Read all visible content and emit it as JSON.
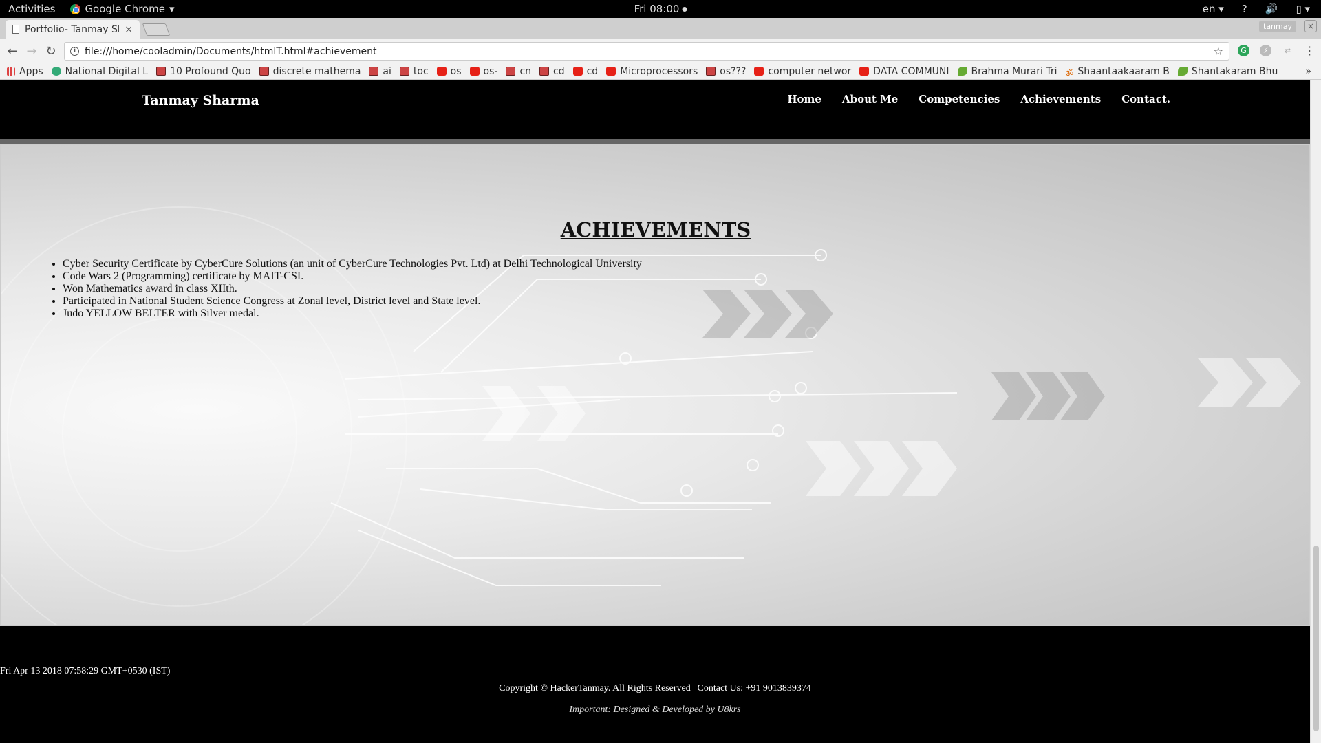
{
  "system_bar": {
    "activities": "Activities",
    "app_name": "Google Chrome",
    "clock": "Fri 08:00",
    "language": "en"
  },
  "browser": {
    "tab_title": "Portfolio- Tanmay Sharma",
    "tab_close": "×",
    "profile_name": "tanmay",
    "url": "file:///home/cooladmin/Documents/htmlT.html#achievement",
    "bookmarks": [
      {
        "label": "Apps",
        "icon": "apps-icon"
      },
      {
        "label": "National Digital L",
        "icon": "gov-icon"
      },
      {
        "label": "10 Profound Quo",
        "icon": "book-icon"
      },
      {
        "label": "discrete mathema",
        "icon": "book-icon"
      },
      {
        "label": "ai",
        "icon": "book-icon"
      },
      {
        "label": "toc",
        "icon": "book-icon"
      },
      {
        "label": "os",
        "icon": "youtube-icon"
      },
      {
        "label": "os-",
        "icon": "youtube-icon"
      },
      {
        "label": "cn",
        "icon": "book-icon"
      },
      {
        "label": "cd",
        "icon": "book-icon"
      },
      {
        "label": "cd",
        "icon": "youtube-icon"
      },
      {
        "label": "Microprocessors",
        "icon": "youtube-icon"
      },
      {
        "label": "os???",
        "icon": "book-icon"
      },
      {
        "label": "computer networ",
        "icon": "youtube-icon"
      },
      {
        "label": "DATA COMMUNI",
        "icon": "youtube-icon"
      },
      {
        "label": "Brahma Murari Tri",
        "icon": "leaf-icon"
      },
      {
        "label": "Shaantaakaaram B",
        "icon": "om-icon"
      },
      {
        "label": "Shantakaram Bhu",
        "icon": "leaf-icon"
      }
    ],
    "bookmarks_more": "»"
  },
  "site": {
    "brand": "Tanmay Sharma",
    "nav": [
      "Home",
      "About Me",
      "Competencies",
      "Achievements",
      "Contact."
    ],
    "section_title": "ACHIEVEMENTS",
    "achievements": [
      "Cyber Security Certificate by CyberCure Solutions (an unit of CyberCure Technologies Pvt. Ltd) at Delhi Technological University",
      "Code Wars 2 (Programming) certificate by MAIT-CSI.",
      "Won Mathematics award in class XIIth.",
      "Participated in National Student Science Congress at Zonal level, District level and State level.",
      "Judo YELLOW BELTER with Silver medal."
    ],
    "footer": {
      "date": "Fri Apr 13 2018 07:58:29 GMT+0530 (IST)",
      "copyright": "Copyright © HackerTanmay. All Rights Reserved | Contact Us: +91 9013839374",
      "credit": "Important: Designed & Developed by U8krs"
    }
  }
}
